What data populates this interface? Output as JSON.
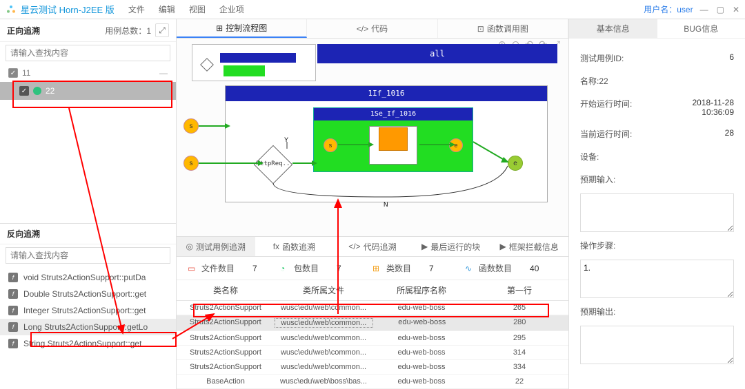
{
  "app": {
    "title": "星云测试 Horn-J2EE 版",
    "user_label": "用户名：",
    "user": "user"
  },
  "menu": [
    "文件",
    "编辑",
    "视图",
    "企业项"
  ],
  "left_top": {
    "title": "正向追溯",
    "count_label": "用例总数：",
    "count": "1",
    "search_placeholder": "请输入查找内容",
    "rows": [
      {
        "id": "11",
        "label": "11"
      },
      {
        "id": "22",
        "label": "22"
      }
    ]
  },
  "left_bot": {
    "title": "反向追溯",
    "search_placeholder": "请输入查找内容",
    "items": [
      "void Struts2ActionSupport::putDa",
      "Double Struts2ActionSupport::get",
      "Integer Struts2ActionSupport::get",
      "Long Struts2ActionSupport::getLo",
      "String Struts2ActionSupport::get"
    ]
  },
  "center_tabs": [
    "控制流程图",
    "代码",
    "函数调用图"
  ],
  "diagram": {
    "all": "all",
    "flow_title": "1If_1016",
    "s": "s",
    "httpreq": "HttpReq..",
    "inner_title": "1Se_If_1016",
    "e": "e",
    "y": "Y",
    "n": "N"
  },
  "bottom_tabs": [
    "测试用例追溯",
    "函数追溯",
    "代码追溯",
    "最后运行的块",
    "框架拦截信息"
  ],
  "stats": [
    {
      "label": "文件数目",
      "val": "7",
      "color": "#e74c3c"
    },
    {
      "label": "包数目",
      "val": "7",
      "color": "#2ecc71"
    },
    {
      "label": "类数目",
      "val": "7",
      "color": "#f39c12"
    },
    {
      "label": "函数数目",
      "val": "40",
      "color": "#3498db"
    }
  ],
  "table": {
    "headers": [
      "类名称",
      "类所属文件",
      "所属程序名称",
      "第一行"
    ],
    "rows": [
      [
        "Struts2ActionSupport",
        "wusc\\edu\\web\\common...",
        "edu-web-boss",
        "265"
      ],
      [
        "Struts2ActionSupport",
        "wusc\\edu\\web\\common...",
        "edu-web-boss",
        "280"
      ],
      [
        "Struts2ActionSupport",
        "wusc\\edu\\web\\common...",
        "edu-web-boss",
        "295"
      ],
      [
        "Struts2ActionSupport",
        "wusc\\edu\\web\\common...",
        "edu-web-boss",
        "314"
      ],
      [
        "Struts2ActionSupport",
        "wusc\\edu\\web\\common...",
        "edu-web-boss",
        "334"
      ],
      [
        "BaseAction",
        "wusc\\edu\\web\\boss\\bas...",
        "edu-web-boss",
        "22"
      ]
    ]
  },
  "right_tabs": [
    "基本信息",
    "BUG信息"
  ],
  "info": {
    "testid_k": "测试用例ID:",
    "testid_v": "6",
    "name_k": "名称:22",
    "start_k": "开始运行时间:",
    "start_v": "2018-11-28\n10:36:09",
    "cur_k": "当前运行时间:",
    "cur_v": "28",
    "dev_k": "设备:",
    "expin_k": "预期输入:",
    "steps_k": "操作步骤:",
    "steps_v": "1.",
    "expout_k": "预期输出:"
  }
}
